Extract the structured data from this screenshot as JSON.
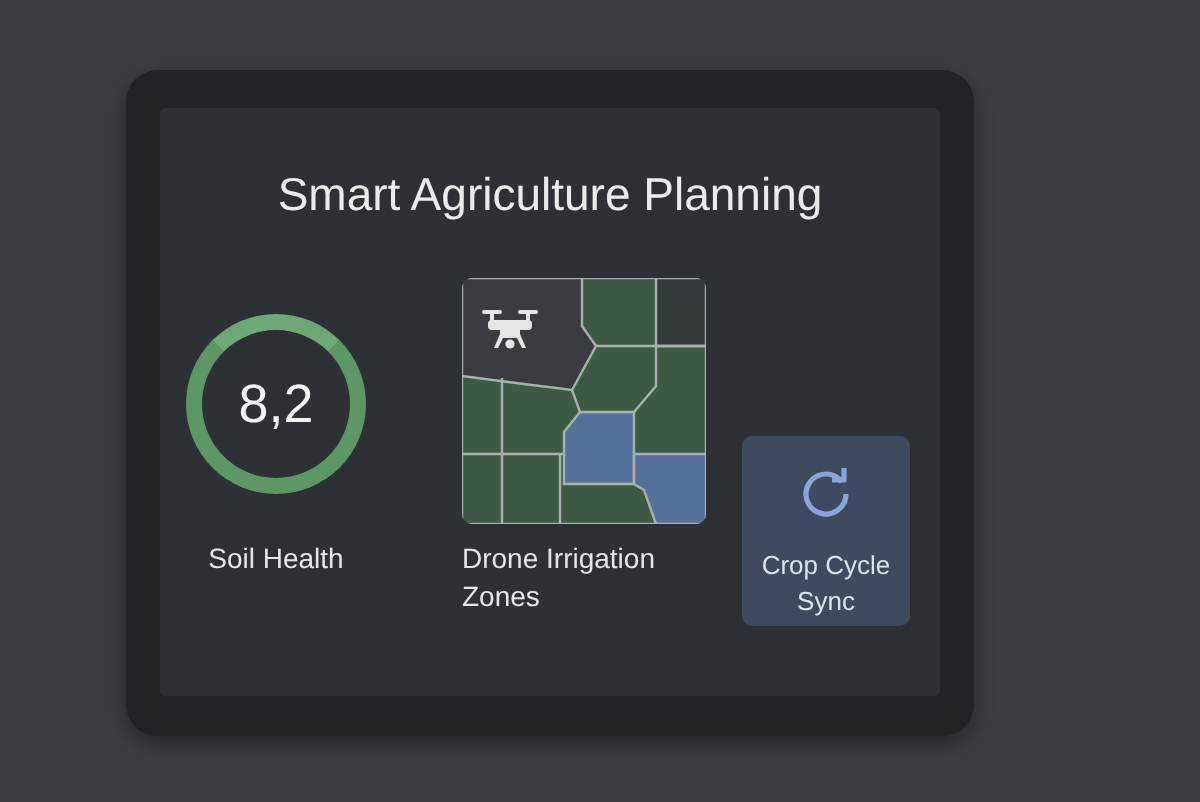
{
  "screen": {
    "title": "Smart Agriculture Planning"
  },
  "widgets": [
    {
      "kind": "gauge",
      "value": "8,2",
      "label": "Soil Health"
    },
    {
      "kind": "map",
      "label": "Drone Irrigation Zones"
    },
    {
      "kind": "action",
      "label": "Crop Cycle Sync"
    }
  ]
}
